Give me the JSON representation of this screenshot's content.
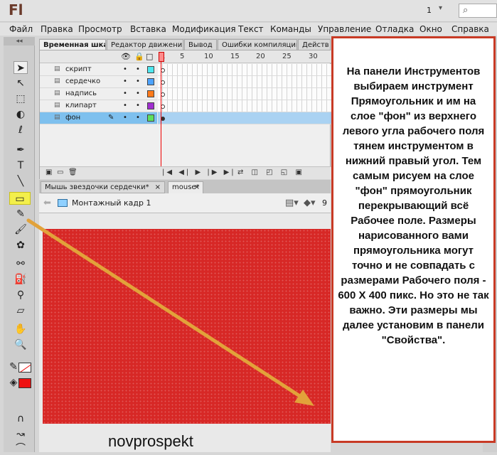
{
  "app": {
    "logo": "Fl",
    "workspace_num": "1"
  },
  "menu": [
    "Файл",
    "Правка",
    "Просмотр",
    "Вставка",
    "Модификация",
    "Текст",
    "Команды",
    "Управление",
    "Отладка",
    "Окно",
    "Справка"
  ],
  "panel_tabs": [
    "Временная шкала",
    "Редактор движения",
    "Вывод",
    "Ошибки компиляции",
    "Действ"
  ],
  "timeline": {
    "frame_numbers": [
      "1",
      "5",
      "10",
      "15",
      "20",
      "25",
      "30"
    ],
    "layers": [
      {
        "name": "скрипт",
        "color": "#4ee8f0"
      },
      {
        "name": "сердечко",
        "color": "#4da3ff"
      },
      {
        "name": "надпись",
        "color": "#ff7a1a"
      },
      {
        "name": "клипарт",
        "color": "#a02fd0"
      },
      {
        "name": "фон",
        "color": "#5ee05e"
      }
    ]
  },
  "doc_tabs": [
    {
      "label": "Мышь звездочки сердечки*"
    },
    {
      "label": "mouse*"
    }
  ],
  "edit_bar": {
    "scene": "Монтажный кадр 1",
    "zoom": "9"
  },
  "colors": {
    "fill": "#ee1111",
    "stroke": "none",
    "stage": "#d72826",
    "highlight": "#f3ef4b",
    "arrow": "#e2a23a",
    "callout_border": "#c83a25"
  },
  "watermark": "novprospekt",
  "callout": "На панели Инструментов выбираем инструмент Прямоугольник и им на слое \"фон\" из верхнего левого угла рабочего поля тянем инструментом в нижний правый угол. Тем самым рисуем на слое \"фон\" прямоугольник перекрывающий всё Рабочее поле. Размеры нарисованного вами прямоугольника могут точно и не совпадать с размерами Рабочего поля - 600 Х 400 пикс. Но это не так важно. Эти размеры мы далее установим в панели \"Свойства\"."
}
